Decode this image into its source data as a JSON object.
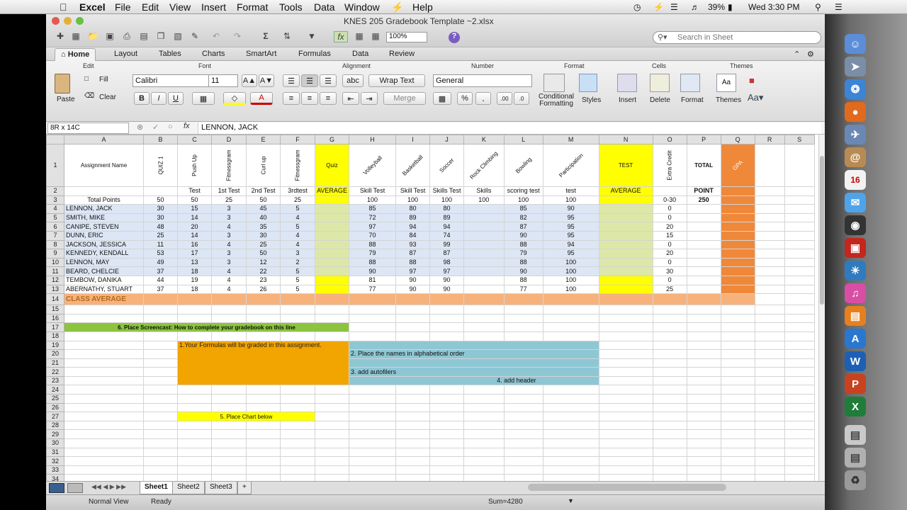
{
  "menubar": {
    "app": "Excel",
    "items": [
      "File",
      "Edit",
      "View",
      "Insert",
      "Format",
      "Tools",
      "Data",
      "Window",
      "Help"
    ],
    "battery": "39%",
    "clock": "Wed 3:30 PM"
  },
  "window": {
    "title": "KNES 205 Gradebook Template ~2.xlsx",
    "zoom": "100%",
    "search_placeholder": "Search in Sheet"
  },
  "ribbon": {
    "tabs": [
      "Home",
      "Layout",
      "Tables",
      "Charts",
      "SmartArt",
      "Formulas",
      "Data",
      "Review"
    ],
    "groups": [
      "Edit",
      "Font",
      "Alignment",
      "Number",
      "Format",
      "Cells",
      "Themes"
    ],
    "fill": "Fill",
    "clear": "Clear",
    "paste": "Paste",
    "font": "Calibri",
    "size": "11",
    "wrap": "Wrap Text",
    "merge": "Merge",
    "numfmt": "General",
    "cond": "Conditional Formatting",
    "styles": "Styles",
    "insert": "Insert",
    "delete": "Delete",
    "format": "Format",
    "themes": "Themes"
  },
  "formula_bar": {
    "name_box": "8R x 14C",
    "value": "LENNON, JACK"
  },
  "columns": [
    "A",
    "B",
    "C",
    "D",
    "E",
    "F",
    "G",
    "H",
    "I",
    "J",
    "K",
    "L",
    "M",
    "N",
    "O",
    "P",
    "Q",
    "R",
    "S"
  ],
  "row1": {
    "A": "Assignment Name",
    "B": "QUIZ 1",
    "C": "Push Up",
    "D": "Fitnessgram",
    "E": "Curl up",
    "F": "Fitnessgram",
    "G": "Quiz",
    "H": "Volleyball",
    "I": "Basketball",
    "J": "Soccer",
    "K": "Rock Climbing",
    "L": "Bowling",
    "M": "Participation",
    "N": "TEST",
    "O": "Extra Credit",
    "P": "TOTAL",
    "Q": "GPA"
  },
  "row2": [
    "",
    "",
    "Test",
    "1st Test",
    "2nd Test",
    "3rdtest",
    "AVERAGE",
    "Skill Test",
    "Skill Test",
    "Skills Test",
    "Skills",
    "scoring test",
    "test",
    "AVERAGE",
    "",
    "POINT",
    ""
  ],
  "row3": [
    "Total Points",
    "50",
    "50",
    "25",
    "50",
    "25",
    "",
    "100",
    "100",
    "100",
    "100",
    "100",
    "100",
    "",
    "0-30",
    "250",
    ""
  ],
  "students": [
    [
      "LENNON, JACK",
      "30",
      "15",
      "3",
      "45",
      "5",
      "",
      "85",
      "80",
      "80",
      "",
      "85",
      "90",
      "",
      "0",
      "",
      ""
    ],
    [
      "SMITH, MIKE",
      "30",
      "14",
      "3",
      "40",
      "4",
      "",
      "72",
      "89",
      "89",
      "",
      "82",
      "95",
      "",
      "0",
      "",
      ""
    ],
    [
      "CANIPE, STEVEN",
      "48",
      "20",
      "4",
      "35",
      "5",
      "",
      "97",
      "94",
      "94",
      "",
      "87",
      "95",
      "",
      "20",
      "",
      ""
    ],
    [
      "DUNN, ERIC",
      "25",
      "14",
      "3",
      "30",
      "4",
      "",
      "70",
      "84",
      "74",
      "",
      "90",
      "95",
      "",
      "15",
      "",
      ""
    ],
    [
      "JACKSON, JESSICA",
      "11",
      "16",
      "4",
      "25",
      "4",
      "",
      "88",
      "93",
      "99",
      "",
      "88",
      "94",
      "",
      "0",
      "",
      ""
    ],
    [
      "KENNEDY, KENDALL",
      "53",
      "17",
      "3",
      "50",
      "3",
      "",
      "79",
      "87",
      "87",
      "",
      "79",
      "95",
      "",
      "20",
      "",
      ""
    ],
    [
      "LENNON, MAY",
      "49",
      "13",
      "3",
      "12",
      "2",
      "",
      "88",
      "88",
      "98",
      "",
      "88",
      "100",
      "",
      "0",
      "",
      ""
    ],
    [
      "BEARD, CHELCIE",
      "37",
      "18",
      "4",
      "22",
      "5",
      "",
      "90",
      "97",
      "97",
      "",
      "90",
      "100",
      "",
      "30",
      "",
      ""
    ],
    [
      "TEMBOW, DANIKA",
      "44",
      "19",
      "4",
      "23",
      "5",
      "",
      "81",
      "90",
      "90",
      "",
      "88",
      "100",
      "",
      "0",
      "",
      ""
    ],
    [
      "ABERNATHY, STUART",
      "37",
      "18",
      "4",
      "26",
      "5",
      "",
      "77",
      "90",
      "90",
      "",
      "77",
      "100",
      "",
      "25",
      "",
      ""
    ]
  ],
  "class_average": "CLASS AVERAGE",
  "notes": {
    "n6": "6. Place Screencast: How to complete your gradebook on this line",
    "n1": "1.Your Formulas will be graded in this assignment.",
    "n2": "2. Place the names in alphabetical order",
    "n3": "3. add autofilers",
    "n4": "4. add header",
    "n5": "5. Place Chart below"
  },
  "row_numbers": [
    "1",
    "2",
    "3",
    "4",
    "5",
    "6",
    "7",
    "8",
    "9",
    "10",
    "11",
    "12",
    "13",
    "14",
    "15",
    "16",
    "17",
    "18",
    "19",
    "20",
    "21",
    "22",
    "23",
    "24",
    "25",
    "26",
    "27",
    "28",
    "29",
    "30",
    "31",
    "32",
    "33",
    "34",
    "35"
  ],
  "sheets": [
    "Sheet1",
    "Sheet2",
    "Sheet3",
    "+"
  ],
  "status": {
    "view": "Normal View",
    "state": "Ready",
    "sum": "Sum=4280"
  },
  "colors": {
    "yellow": "#ffff00",
    "ylgreen": "#dde8a8",
    "orange": "#f0883a",
    "peach": "#f7b27c",
    "green": "#8cc43f",
    "teal": "#8ec7d4",
    "amber": "#f2a400",
    "blue_sel": "#dce6f5"
  }
}
